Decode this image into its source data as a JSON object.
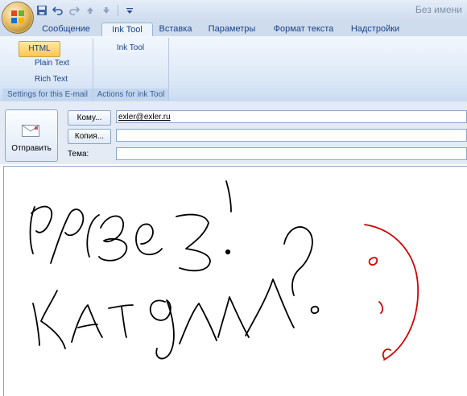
{
  "quick_access": {
    "save_icon": "save-icon",
    "undo_icon": "undo-icon",
    "redo_icon": "redo-icon",
    "up_icon": "up-arrow-icon",
    "down_icon": "down-arrow-icon",
    "customize_icon": "customize-dropdown-icon"
  },
  "window": {
    "title": "Без имени"
  },
  "tabs": [
    "Сообщение",
    "Ink Tool",
    "Вставка",
    "Параметры",
    "Формат текста",
    "Надстройки"
  ],
  "ribbon": {
    "group1": {
      "label": "Settings for this E-mail",
      "buttons": [
        "HTML",
        "Plain Text",
        "Rich Text"
      ],
      "selected": "HTML"
    },
    "group2": {
      "label": "Actions for ink Tool",
      "button": "Ink Tool"
    }
  },
  "compose": {
    "send_label": "Отправить",
    "to_button": "Кому...",
    "cc_button": "Копия...",
    "subject_label": "Тема:",
    "to_value": "exler@exler.ru",
    "cc_value": "",
    "subject_value": ""
  },
  "colors": {
    "ink_black": "#000000",
    "ink_red": "#d40000",
    "accent": "#15428b"
  }
}
